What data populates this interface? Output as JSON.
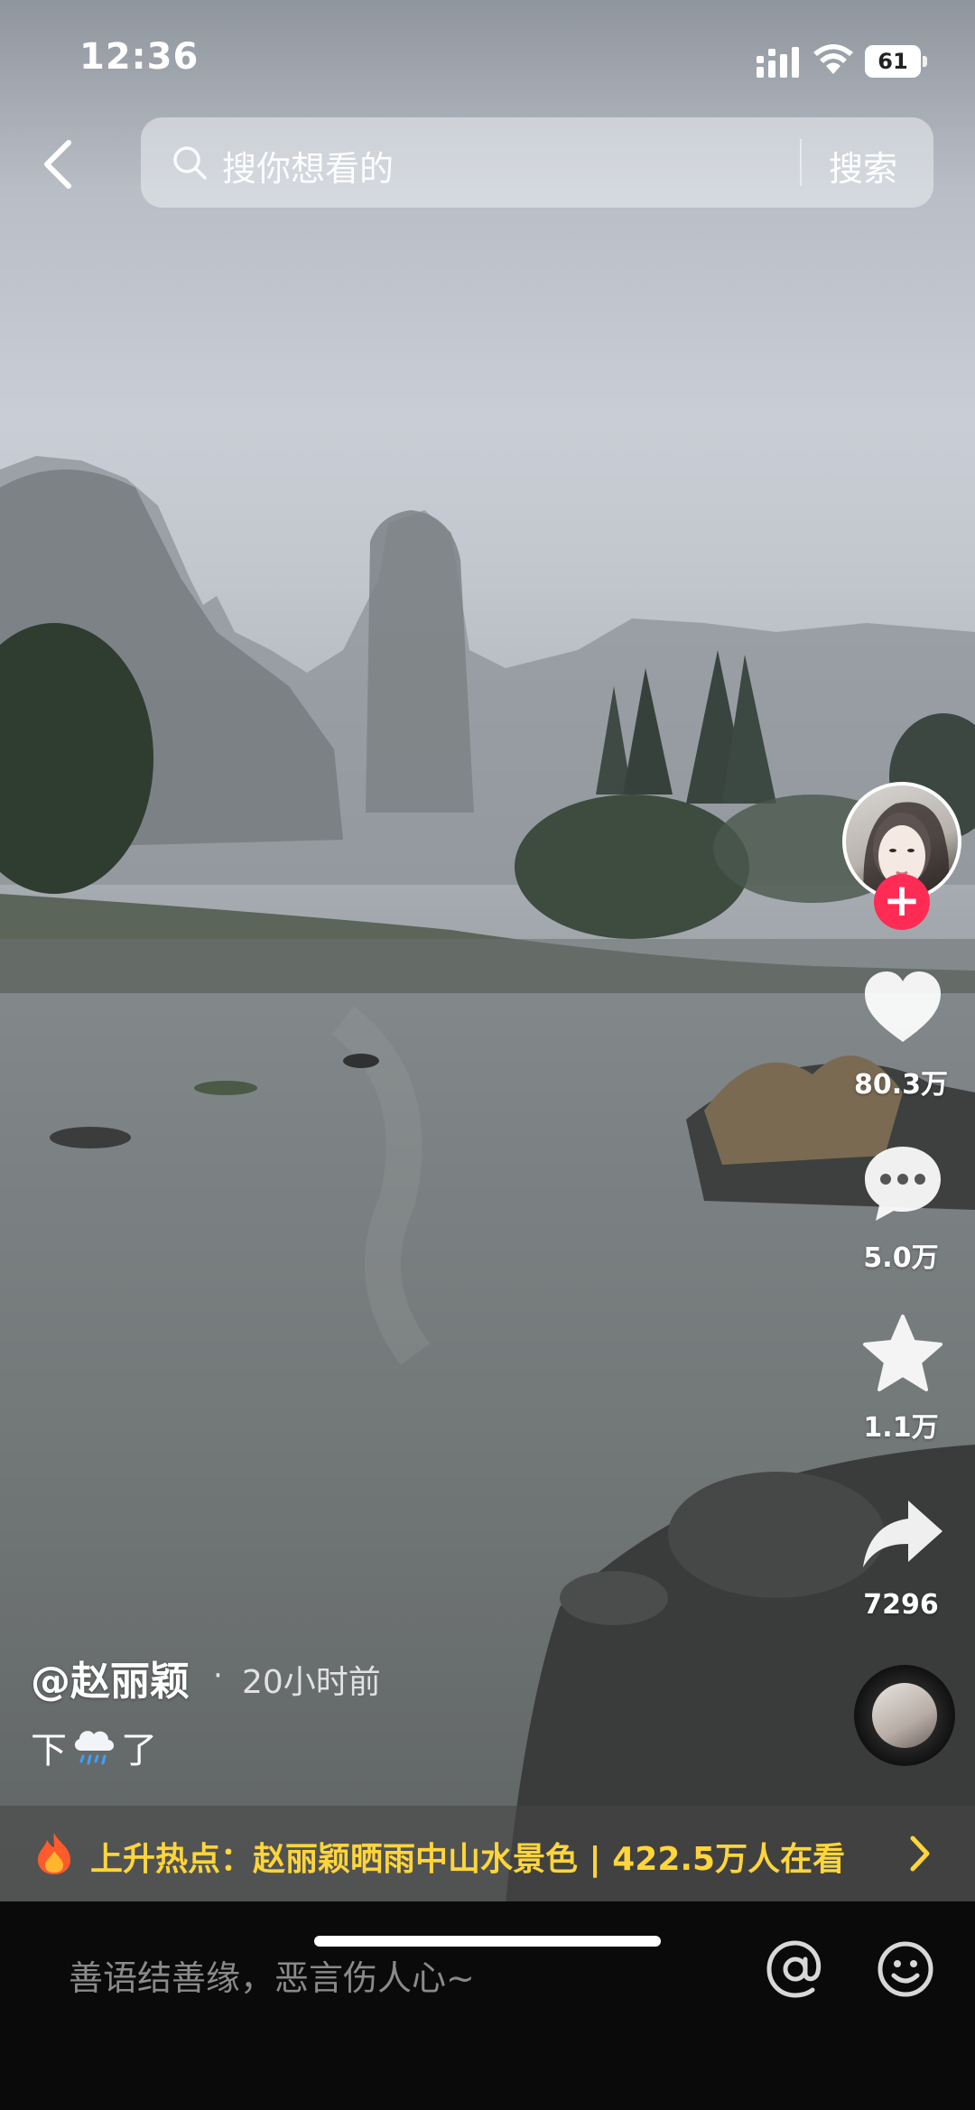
{
  "status_bar": {
    "time": "12:36",
    "battery": "61"
  },
  "search": {
    "placeholder": "搜你想看的",
    "button": "搜索"
  },
  "creator": {
    "follow_symbol": "+"
  },
  "actions": {
    "likes": "80.3万",
    "comments": "5.0万",
    "favorites": "1.1万",
    "shares": "7296"
  },
  "post": {
    "author": "@赵丽颖",
    "separator": "·",
    "time_ago": "20小时前",
    "caption_before": "下",
    "caption_emoji": "cloud-rain-emoji",
    "caption_after": "了"
  },
  "hot_topic": {
    "text": "上升热点：赵丽颖晒雨中山水景色 | 422.5万人在看"
  },
  "comment_input": {
    "placeholder": "善语结善缘，恶言伤人心~"
  },
  "icons": {
    "back": "chevron-left-icon",
    "search": "search-icon",
    "like": "heart-icon",
    "comment": "comment-bubble-icon",
    "favorite": "star-icon",
    "share": "share-arrow-icon",
    "mention": "at-sign-icon",
    "emoji": "smiley-icon",
    "hot": "flame-icon"
  },
  "colors": {
    "accent_pink": "#fe2c55",
    "hot_yellow": "#ffd53b"
  }
}
